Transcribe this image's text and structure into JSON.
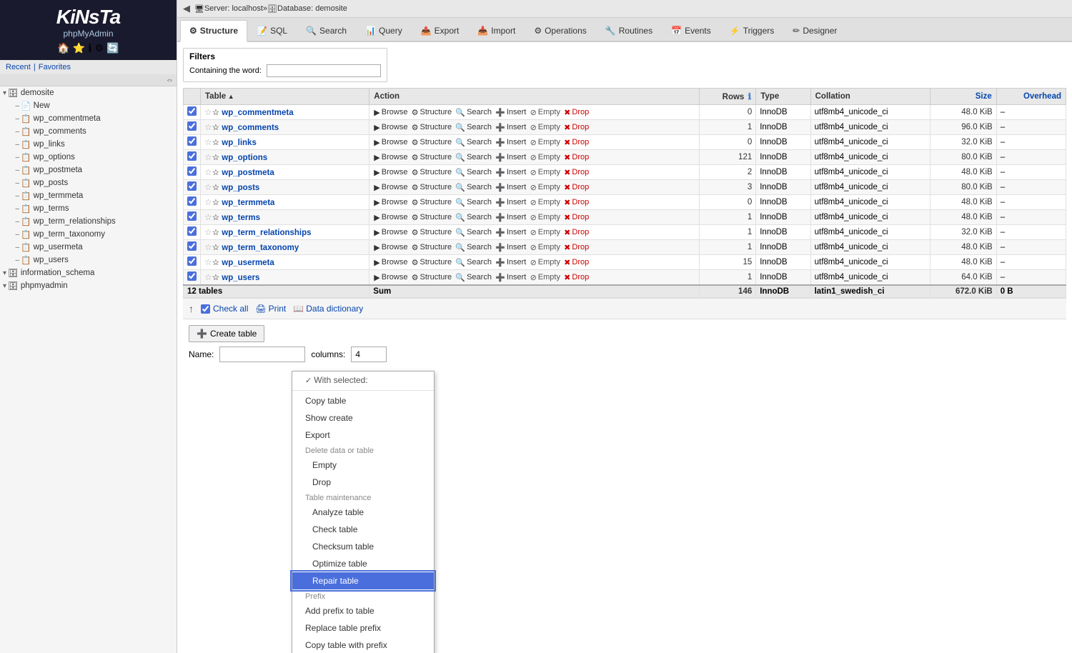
{
  "sidebar": {
    "logo": "KinSta",
    "logo_display": "KiNsTa",
    "sub": "phpMyAdmin",
    "recent": "Recent",
    "favorites": "Favorites",
    "trees": [
      {
        "label": "demosite",
        "type": "db",
        "level": 0,
        "expanded": true
      },
      {
        "label": "New",
        "type": "new",
        "level": 1
      },
      {
        "label": "wp_commentmeta",
        "type": "table",
        "level": 1
      },
      {
        "label": "wp_comments",
        "type": "table",
        "level": 1
      },
      {
        "label": "wp_links",
        "type": "table",
        "level": 1
      },
      {
        "label": "wp_options",
        "type": "table",
        "level": 1
      },
      {
        "label": "wp_postmeta",
        "type": "table",
        "level": 1
      },
      {
        "label": "wp_posts",
        "type": "table",
        "level": 1
      },
      {
        "label": "wp_termmeta",
        "type": "table",
        "level": 1
      },
      {
        "label": "wp_terms",
        "type": "table",
        "level": 1
      },
      {
        "label": "wp_term_relationships",
        "type": "table",
        "level": 1
      },
      {
        "label": "wp_term_taxonomy",
        "type": "table",
        "level": 1
      },
      {
        "label": "wp_usermeta",
        "type": "table",
        "level": 1
      },
      {
        "label": "wp_users",
        "type": "table",
        "level": 1
      },
      {
        "label": "information_schema",
        "type": "db",
        "level": 0
      },
      {
        "label": "phpmyadmin",
        "type": "db",
        "level": 0
      }
    ]
  },
  "breadcrumb": {
    "server": "Server: localhost",
    "db": "Database: demosite"
  },
  "tabs": [
    {
      "label": "Structure",
      "icon": "⚙",
      "active": true
    },
    {
      "label": "SQL",
      "icon": "📝",
      "active": false
    },
    {
      "label": "Search",
      "icon": "🔍",
      "active": false
    },
    {
      "label": "Query",
      "icon": "📊",
      "active": false
    },
    {
      "label": "Export",
      "icon": "📤",
      "active": false
    },
    {
      "label": "Import",
      "icon": "📥",
      "active": false
    },
    {
      "label": "Operations",
      "icon": "⚙",
      "active": false
    },
    {
      "label": "Routines",
      "icon": "🔧",
      "active": false
    },
    {
      "label": "Events",
      "icon": "📅",
      "active": false
    },
    {
      "label": "Triggers",
      "icon": "⚡",
      "active": false
    },
    {
      "label": "Designer",
      "icon": "✏",
      "active": false
    }
  ],
  "filters": {
    "title": "Filters",
    "containing_label": "Containing the word:"
  },
  "table_headers": {
    "table": "Table",
    "action": "Action",
    "rows": "Rows",
    "type": "Type",
    "collation": "Collation",
    "size": "Size",
    "overhead": "Overhead"
  },
  "tables": [
    {
      "name": "wp_commentmeta",
      "rows": 0,
      "type": "InnoDB",
      "collation": "utf8mb4_unicode_ci",
      "size": "48.0 KiB",
      "overhead": "–"
    },
    {
      "name": "wp_comments",
      "rows": 1,
      "type": "InnoDB",
      "collation": "utf8mb4_unicode_ci",
      "size": "96.0 KiB",
      "overhead": "–"
    },
    {
      "name": "wp_links",
      "rows": 0,
      "type": "InnoDB",
      "collation": "utf8mb4_unicode_ci",
      "size": "32.0 KiB",
      "overhead": "–"
    },
    {
      "name": "wp_options",
      "rows": 121,
      "type": "InnoDB",
      "collation": "utf8mb4_unicode_ci",
      "size": "80.0 KiB",
      "overhead": "–"
    },
    {
      "name": "wp_postmeta",
      "rows": 2,
      "type": "InnoDB",
      "collation": "utf8mb4_unicode_ci",
      "size": "48.0 KiB",
      "overhead": "–"
    },
    {
      "name": "wp_posts",
      "rows": 3,
      "type": "InnoDB",
      "collation": "utf8mb4_unicode_ci",
      "size": "80.0 KiB",
      "overhead": "–"
    },
    {
      "name": "wp_termmeta",
      "rows": 0,
      "type": "InnoDB",
      "collation": "utf8mb4_unicode_ci",
      "size": "48.0 KiB",
      "overhead": "–"
    },
    {
      "name": "wp_terms",
      "rows": 1,
      "type": "InnoDB",
      "collation": "utf8mb4_unicode_ci",
      "size": "48.0 KiB",
      "overhead": "–"
    },
    {
      "name": "wp_term_relationships",
      "rows": 1,
      "type": "InnoDB",
      "collation": "utf8mb4_unicode_ci",
      "size": "32.0 KiB",
      "overhead": "–"
    },
    {
      "name": "wp_term_taxonomy",
      "rows": 1,
      "type": "InnoDB",
      "collation": "utf8mb4_unicode_ci",
      "size": "48.0 KiB",
      "overhead": "–"
    },
    {
      "name": "wp_usermeta",
      "rows": 15,
      "type": "InnoDB",
      "collation": "utf8mb4_unicode_ci",
      "size": "48.0 KiB",
      "overhead": "–"
    },
    {
      "name": "wp_users",
      "rows": 1,
      "type": "InnoDB",
      "collation": "utf8mb4_unicode_ci",
      "size": "64.0 KiB",
      "overhead": "–"
    }
  ],
  "footer": {
    "tables_count": "12 tables",
    "sum_label": "Sum",
    "total_rows": 146,
    "total_type": "InnoDB",
    "total_collation": "latin1_swedish_ci",
    "total_size": "672.0 KiB",
    "total_overhead": "0 B"
  },
  "bottom_bar": {
    "check_all": "Check all",
    "print": "Print",
    "data_dictionary": "Data dictionary"
  },
  "create_table": {
    "button": "Create table",
    "name_label": "Name:",
    "columns_label": "columns:",
    "columns_value": "4"
  },
  "dropdown": {
    "items": [
      {
        "label": "With selected:",
        "type": "section-header",
        "checked": true
      },
      {
        "label": "Copy table",
        "type": "item"
      },
      {
        "label": "Show create",
        "type": "item"
      },
      {
        "label": "Export",
        "type": "item"
      },
      {
        "label": "Delete data or table",
        "type": "disabled-label"
      },
      {
        "label": "Empty",
        "type": "item",
        "indent": true
      },
      {
        "label": "Drop",
        "type": "item",
        "indent": true
      },
      {
        "label": "Table maintenance",
        "type": "disabled-label"
      },
      {
        "label": "Analyze table",
        "type": "item",
        "indent": true
      },
      {
        "label": "Check table",
        "type": "item",
        "indent": true
      },
      {
        "label": "Checksum table",
        "type": "item",
        "indent": true
      },
      {
        "label": "Optimize table",
        "type": "item",
        "indent": true
      },
      {
        "label": "Repair table",
        "type": "item",
        "indent": true,
        "highlighted": true
      },
      {
        "label": "Prefix",
        "type": "disabled-label"
      },
      {
        "label": "Add prefix to table",
        "type": "item"
      },
      {
        "label": "Replace table prefix",
        "type": "item"
      },
      {
        "label": "Copy table with prefix",
        "type": "item"
      }
    ]
  }
}
